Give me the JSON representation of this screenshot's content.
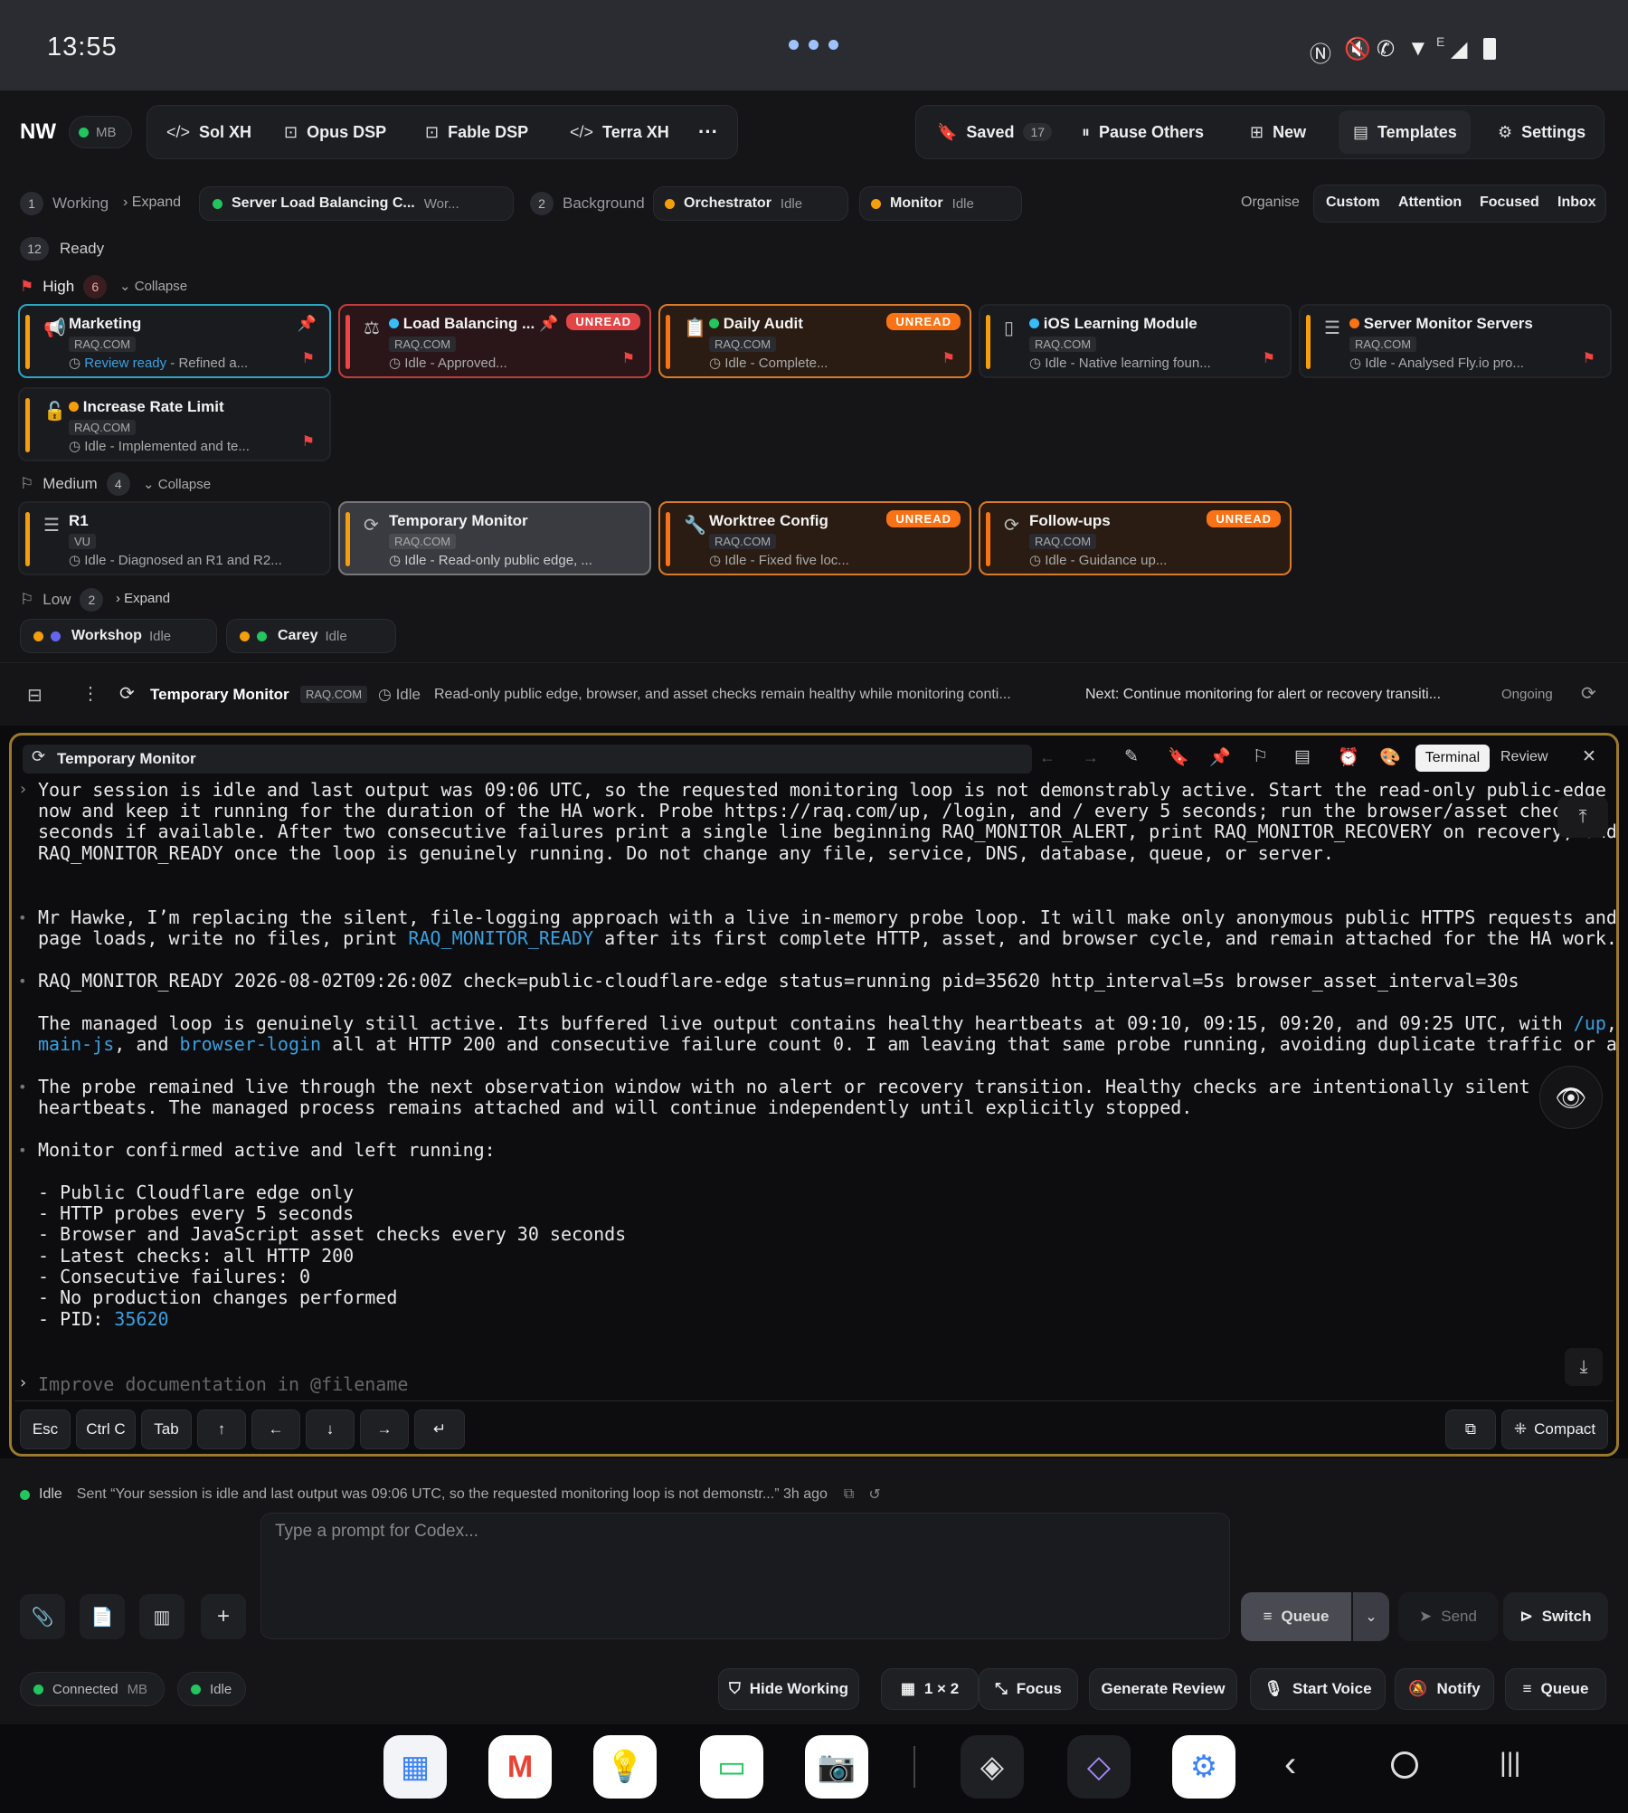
{
  "status_bar": {
    "time": "13:55",
    "icons": [
      "nfc-icon",
      "mute-icon",
      "call-icon",
      "wifi-icon",
      "signal-icon",
      "battery-icon"
    ],
    "network_label": "E"
  },
  "nav": {
    "brand": "NW",
    "brand_status": "MB",
    "tabs": [
      {
        "label": "Sol XH",
        "icon": "code-icon"
      },
      {
        "label": "Opus DSP",
        "icon": "robot-icon"
      },
      {
        "label": "Fable DSP",
        "icon": "robot-icon"
      },
      {
        "label": "Terra XH",
        "icon": "code-icon"
      }
    ],
    "more": "···",
    "actions": [
      {
        "label": "Saved",
        "count": "17",
        "icon": "bookmark-icon"
      },
      {
        "label": "Pause Others",
        "icon": "pause-icon"
      },
      {
        "label": "New",
        "icon": "new-icon"
      },
      {
        "label": "Templates",
        "icon": "templates-icon"
      },
      {
        "label": "Settings",
        "icon": "settings-icon"
      }
    ]
  },
  "filters": {
    "working_count": "1",
    "working_label": "Working",
    "expand": "Expand",
    "session1": {
      "title": "Server Load Balancing C...",
      "state": "Wor..."
    },
    "background_count": "2",
    "background_label": "Background",
    "session2": {
      "title": "Orchestrator",
      "state": "Idle"
    },
    "session3": {
      "title": "Monitor",
      "state": "Idle"
    },
    "organise": "Organise",
    "views": [
      "Custom",
      "Attention",
      "Focused",
      "Inbox"
    ]
  },
  "ready": {
    "count": "12",
    "label": "Ready"
  },
  "groups": {
    "high": {
      "label": "High",
      "count": "6",
      "toggle": "Collapse"
    },
    "medium": {
      "label": "Medium",
      "count": "4",
      "toggle": "Collapse"
    },
    "low": {
      "label": "Low",
      "count": "2",
      "toggle": "Expand"
    }
  },
  "cards_high": [
    {
      "title": "Marketing",
      "tag": "RAQ.COM",
      "status_hl": "Review ready",
      "status": " - Refined a..."
    },
    {
      "title": "Load Balancing ...",
      "tag": "RAQ.COM",
      "status": "Idle - Approved...",
      "badge": "UNREAD"
    },
    {
      "title": "Daily Audit",
      "tag": "RAQ.COM",
      "status": "Idle - Complete...",
      "badge": "UNREAD"
    },
    {
      "title": "iOS Learning Module",
      "tag": "RAQ.COM",
      "status": "Idle - Native learning foun..."
    },
    {
      "title": "Server Monitor Servers",
      "tag": "RAQ.COM",
      "status": "Idle - Analysed Fly.io pro..."
    },
    {
      "title": "Increase Rate Limit",
      "tag": "RAQ.COM",
      "status": "Idle - Implemented and te..."
    }
  ],
  "cards_medium": [
    {
      "title": "R1",
      "tag": "VU",
      "status": "Idle - Diagnosed an R1 and R2..."
    },
    {
      "title": "Temporary Monitor",
      "tag": "RAQ.COM",
      "status": "Idle - Read-only public edge, ..."
    },
    {
      "title": "Worktree Config",
      "tag": "RAQ.COM",
      "status": "Idle - Fixed five loc...",
      "badge": "UNREAD"
    },
    {
      "title": "Follow-ups",
      "tag": "RAQ.COM",
      "status": "Idle - Guidance up...",
      "badge": "UNREAD"
    }
  ],
  "low_items": [
    {
      "title": "Workshop",
      "state": "Idle"
    },
    {
      "title": "Carey",
      "state": "Idle"
    }
  ],
  "context": {
    "title": "Temporary Monitor",
    "tag": "RAQ.COM",
    "state": "Idle",
    "summary": "Read-only public edge, browser, and asset checks remain healthy while monitoring conti...",
    "next": "Next: Continue monitoring for alert or recovery transiti...",
    "status": "Ongoing"
  },
  "terminal": {
    "title": "Temporary Monitor",
    "tab_terminal": "Terminal",
    "tab_review": "Review",
    "lines": {
      "l1": "Your session is idle and last output was 09:06 UTC, so the requested monitoring loop is not demonstrably active. Start the read-only public-edge",
      "l2": "now and keep it running for the duration of the HA work. Probe https://raq.com/up, /login, and / every 5 seconds; run the browser/asset chec",
      "l3": "seconds if available. After two consecutive failures print a single line beginning RAQ_MONITOR_ALERT, print RAQ_MONITOR_RECOVERY on recovery, and",
      "l4": "RAQ_MONITOR_READY once the loop is genuinely running. Do not change any file, service, DNS, database, queue, or server.",
      "l5": "Mr Hawke, I’m replacing the silent, file-logging approach with a live in-memory probe loop. It will make only anonymous public HTTPS requests and",
      "l6a": "page loads, write no files, print ",
      "l6link": "RAQ_MONITOR_READY",
      "l6b": " after its first complete HTTP, asset, and browser cycle, and remain attached for the HA work.",
      "l7": "RAQ_MONITOR_READY 2026-08-02T09:26:00Z check=public-cloudflare-edge status=running pid=35620 http_interval=5s browser_asset_interval=30s",
      "l8a": "The managed loop is genuinely still active. Its buffered live output contains healthy heartbeats at 09:10, 09:15, 09:20, and 09:25 UTC, with ",
      "l8link": "/up",
      "l8b": ",",
      "l9link1": "main-js",
      "l9a": ", and ",
      "l9link2": "browser-login",
      "l9b": " all at HTTP 200 and consecutive failure count 0. I am leaving that same probe running, avoiding duplicate traffic or a",
      "l10": "The probe remained live through the next observation window with no alert or recovery transition. Healthy checks are intentionally silent  r",
      "l11": "heartbeats. The managed process remains attached and will continue independently until explicitly stopped.",
      "l12": "Monitor confirmed active and left running:",
      "b1": "- Public Cloudflare edge only",
      "b2": "- HTTP probes every 5 seconds",
      "b3": "- Browser and JavaScript asset checks every 30 seconds",
      "b4": "- Latest checks: all HTTP 200",
      "b5": "- Consecutive failures: 0",
      "b6": "- No production changes performed",
      "b7a": "- PID: ",
      "b7link": "35620"
    },
    "prompt_placeholder": "Improve documentation in @filename",
    "keys": [
      "Esc",
      "Ctrl C",
      "Tab",
      "↑",
      "←",
      "↓",
      "→",
      "↵"
    ],
    "compact": "Compact"
  },
  "sent_status": {
    "state": "Idle",
    "message": "Sent “Your session is idle and last output was 09:06 UTC, so the requested monitoring loop is not demonstr...” 3h ago"
  },
  "composer": {
    "placeholder": "Type a prompt for Codex...",
    "queue": "Queue",
    "send": "Send",
    "switch": "Switch"
  },
  "footer": {
    "connected": "Connected",
    "connected_tag": "MB",
    "idle": "Idle",
    "buttons": [
      "Hide Working",
      "1 × 2",
      "Focus",
      "Generate Review",
      "Start Voice",
      "Notify",
      "Queue"
    ]
  },
  "colors": {
    "accent_orange": "#f97316",
    "accent_amber": "#f59e0b",
    "unread_red": "#c23b3b",
    "green": "#22c55e",
    "blue": "#3aa0e0",
    "terminal_border": "#9a7a2a"
  }
}
